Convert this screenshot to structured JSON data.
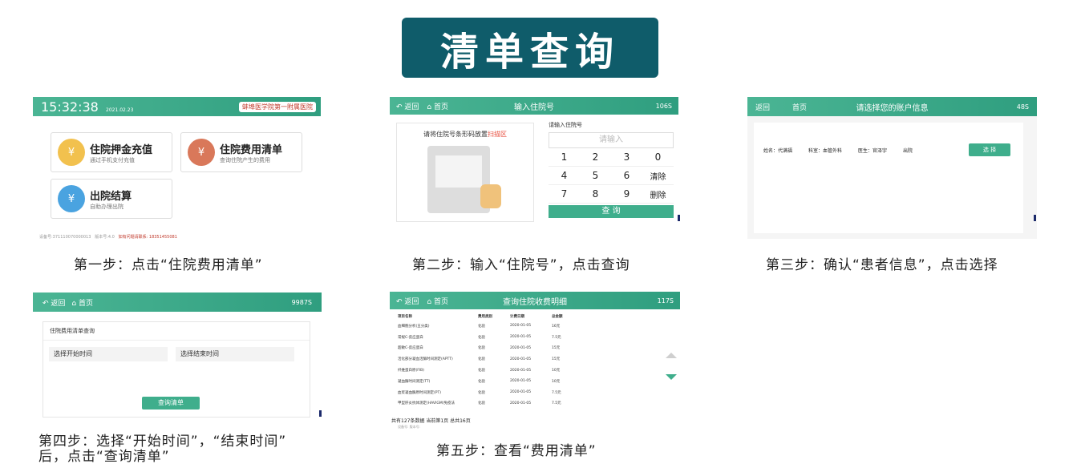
{
  "title": "清单查询",
  "step1": {
    "caption": "第一步：点击“住院费用清单”",
    "clock": "15:32:38",
    "date": "2021.02.23",
    "hospital": "蚌埠医学院第一附属医院",
    "tiles": [
      {
        "label": "住院押金充值",
        "sub": "通过手机支付充值",
        "icon": "¥"
      },
      {
        "label": "住院费用清单",
        "sub": "查询住院产生的费用",
        "icon": "¥"
      },
      {
        "label": "出院结算",
        "sub": "自助办理出院",
        "icon": "¥"
      }
    ],
    "footer_device": "设备号:371110070000013",
    "footer_version": "版本号:4.0",
    "footer_contact": "如有问题请联系: 18351455081"
  },
  "step2": {
    "caption": "第二步：输入“住院号”，点击查询",
    "back": "返回",
    "home": "首页",
    "bar_title": "输入住院号",
    "countdown": "106S",
    "hint_prefix": "请将住院号条形码放置",
    "hint_red": "扫描区",
    "input_label": "请输入住院号",
    "input_placeholder": "请输入",
    "keys": [
      "1",
      "2",
      "3",
      "0",
      "4",
      "5",
      "6",
      "清除",
      "7",
      "8",
      "9",
      "删除"
    ],
    "query": "查 询"
  },
  "step3": {
    "caption": "第三步：确认“患者信息”，点击选择",
    "back": "返回",
    "home": "首页",
    "bar_title": "请选择您的账户信息",
    "countdown": "48S",
    "name": "姓名：代满福",
    "dept": "科室：血管外科",
    "doctor": "医生：官泽宇",
    "status": "出院",
    "select": "选 择"
  },
  "step4": {
    "caption_line1": "第四步：选择“开始时间”，“结束时间”",
    "caption_line2": "后，点击“查询清单”",
    "back": "返回",
    "home": "首页",
    "countdown": "9987S",
    "form_title": "住院费用清单查询",
    "start": "选择开始时间",
    "end": "选择结束时间",
    "query": "查询清单"
  },
  "step5": {
    "caption": "第五步：查看“费用清单”",
    "back": "返回",
    "home": "首页",
    "bar_title": "查询住院收费明细",
    "countdown": "117S",
    "headers": [
      "项目名称",
      "费用类别",
      "计费日期",
      "总金额"
    ],
    "rows": [
      [
        "血细胞分析(五分类)",
        "化验",
        "2020-01-05",
        "16元"
      ],
      [
        "常规C-反应蛋白",
        "化验",
        "2020-01-05",
        "7.5元"
      ],
      [
        "超敏C-反应蛋白",
        "化验",
        "2020-01-05",
        "15元"
      ],
      [
        "活化部分凝血活酶时间测定(APTT)",
        "化验",
        "2020-01-05",
        "15元"
      ],
      [
        "纤维蛋白原(FIB)",
        "化验",
        "2020-01-05",
        "10元"
      ],
      [
        "凝血酶时间测定(TT)",
        "化验",
        "2020-01-05",
        "10元"
      ],
      [
        "血浆凝血酶原时间测定(PT)",
        "化验",
        "2020-01-05",
        "7.5元"
      ],
      [
        "甲型肝炎抗体测定(HAVIGM)免疫法",
        "化验",
        "2020-01-05",
        "7.5元"
      ]
    ],
    "total": "共有127条数据 当前第1页 总共16页",
    "footer": "设备号:      版本号:"
  },
  "colors": {
    "banner": "#0f5c6a",
    "green": "#3fae8c"
  }
}
